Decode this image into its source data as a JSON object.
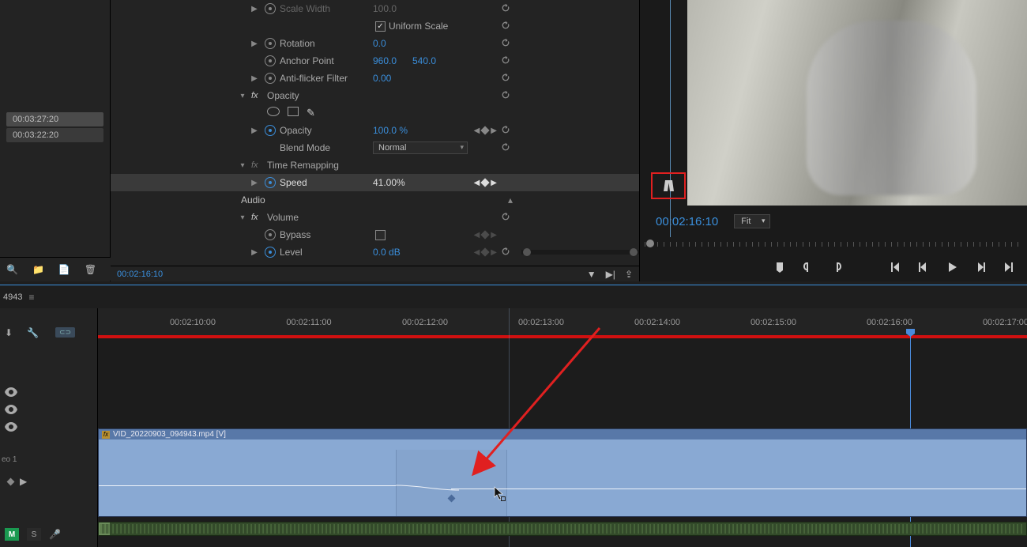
{
  "left_panel": {
    "timecodes": [
      "00:03:27:20",
      "00:03:22:20"
    ]
  },
  "effects": {
    "scale_width": {
      "label": "Scale Width",
      "value": "100.0"
    },
    "uniform_scale": {
      "label": "Uniform Scale"
    },
    "rotation": {
      "label": "Rotation",
      "value": "0.0"
    },
    "anchor": {
      "label": "Anchor Point",
      "x": "960.0",
      "y": "540.0"
    },
    "antiflicker": {
      "label": "Anti-flicker Filter",
      "value": "0.00"
    },
    "opacity_section": {
      "label": "Opacity"
    },
    "opacity": {
      "label": "Opacity",
      "value": "100.0 %"
    },
    "blend": {
      "label": "Blend Mode",
      "value": "Normal"
    },
    "time_remap": {
      "label": "Time Remapping"
    },
    "speed": {
      "label": "Speed",
      "value": "41.00%"
    },
    "audio": {
      "label": "Audio"
    },
    "volume": {
      "label": "Volume"
    },
    "bypass": {
      "label": "Bypass"
    },
    "level": {
      "label": "Level",
      "value": "0.0 dB"
    },
    "footer_tc": "00:02:16:10"
  },
  "program": {
    "timecode": "00:02:16:10",
    "fit": "Fit"
  },
  "sequence": {
    "name": "4943"
  },
  "timeline": {
    "ruler": [
      "00:02:10:00",
      "00:02:11:00",
      "00:02:12:00",
      "00:02:13:00",
      "00:02:14:00",
      "00:02:15:00",
      "00:02:16:00",
      "00:02:17:00"
    ],
    "clip_name": "VID_20220903_094943.mp4 [V]",
    "track_label": "eo 1",
    "mute": "M",
    "solo": "S"
  }
}
